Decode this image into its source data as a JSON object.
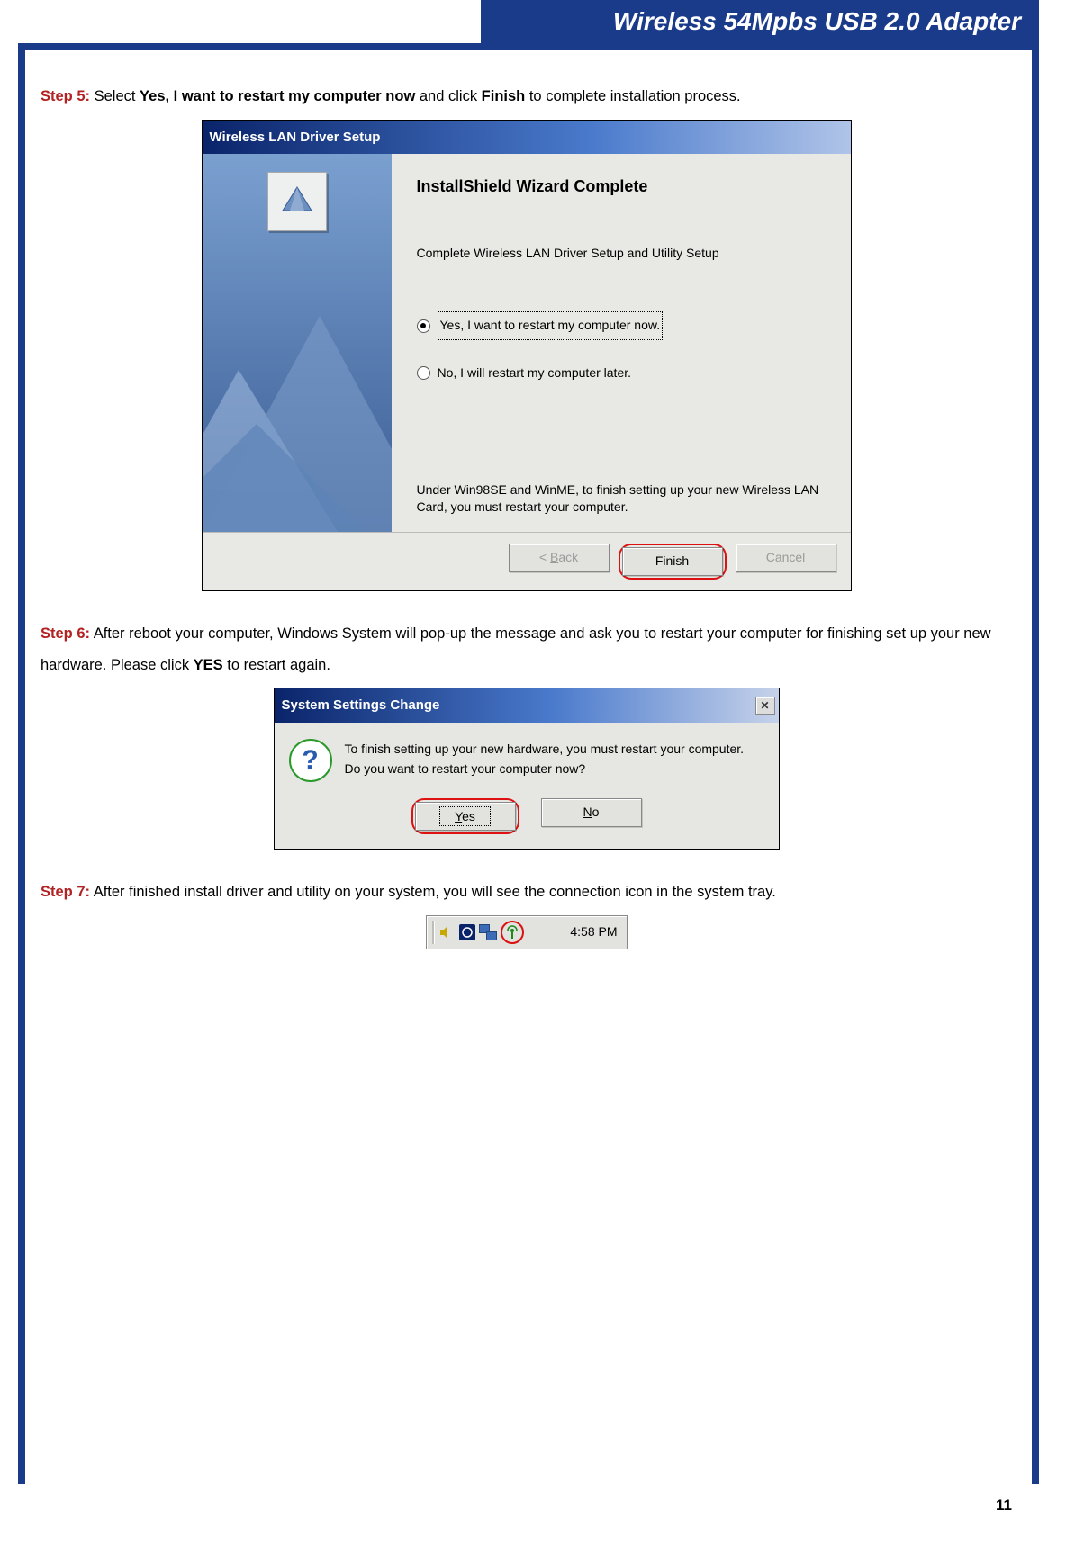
{
  "banner": {
    "title": "Wireless 54Mpbs USB 2.0 Adapter"
  },
  "step5": {
    "label": "Step 5:",
    "pre": " Select ",
    "sel": "Yes, I want to restart my computer now",
    "mid": " and click ",
    "btn": "Finish",
    "post": " to complete installation process."
  },
  "wizard": {
    "title": "Wireless LAN Driver Setup",
    "heading": "InstallShield Wizard Complete",
    "sub": "Complete Wireless LAN Driver Setup and Utility Setup",
    "opt_yes": "Yes, I want to restart my computer now.",
    "opt_no": "No, I will restart my computer later.",
    "note": "Under Win98SE and WinME, to finish setting up your new Wireless LAN Card, you must restart your computer.",
    "back_label": "< Back",
    "finish_label": "Finish",
    "cancel_label": "Cancel"
  },
  "step6": {
    "label": "Step 6:",
    "line1": " After reboot your computer, Windows System will pop-up the message and ask you to restart your computer for finishing set up your new hardware. Please click ",
    "yes": "YES",
    "line2": " to restart again."
  },
  "msg": {
    "title": "System Settings Change",
    "line1": "To finish setting up your new hardware, you must restart your computer.",
    "line2": "Do you want to restart your computer now?",
    "yes": "Yes",
    "no": "No"
  },
  "step7": {
    "label": "Step 7:",
    "text": " After finished install driver and utility on your system, you will see the connection icon in the system tray."
  },
  "tray": {
    "time": "4:58 PM"
  },
  "page_number": "11"
}
